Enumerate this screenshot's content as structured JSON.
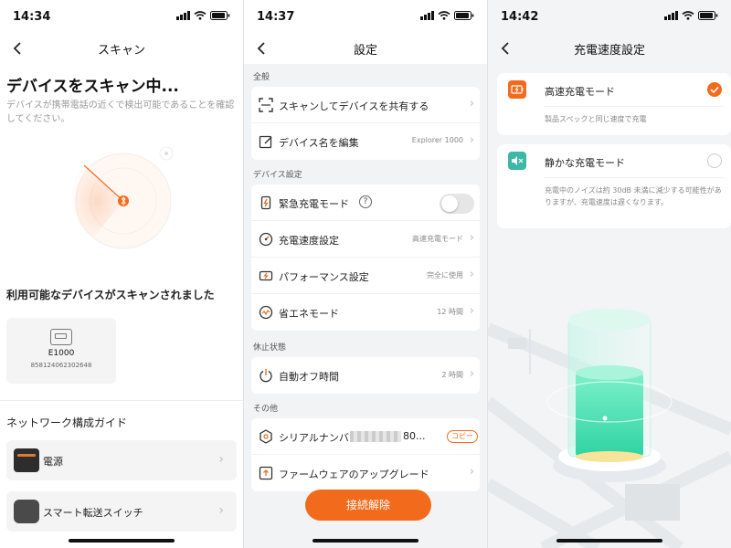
{
  "scan_screen": {
    "time": "14:34",
    "title": "スキャン",
    "heading": "デバイスをスキャン中...",
    "description": "デバイスが携帯電話の近くで検出可能であることを確認してください。",
    "found_heading": "利用可能なデバイスがスキャンされました",
    "device": {
      "name": "E1000",
      "serial": "858124062302648"
    },
    "guide_heading": "ネットワーク構成ガイド",
    "guide_items": [
      {
        "label": "電源"
      },
      {
        "label": "スマート転送スイッチ"
      }
    ]
  },
  "settings_screen": {
    "time": "14:37",
    "title": "設定",
    "sections": {
      "general": "全般",
      "device": "デバイス設定",
      "sleep": "休止状態",
      "other": "その他"
    },
    "general_rows": [
      {
        "label": "スキャンしてデバイスを共有する",
        "value": ""
      },
      {
        "label": "デバイス名を編集",
        "value": "Explorer 1000"
      }
    ],
    "device_rows": [
      {
        "label": "緊急充電モード",
        "value": ""
      },
      {
        "label": "充電速度設定",
        "value": "高速充電モード"
      },
      {
        "label": "パフォーマンス設定",
        "value": "完全に使用"
      },
      {
        "label": "省エネモード",
        "value": "12 時間"
      }
    ],
    "emergency_charge_enabled": false,
    "sleep_rows": [
      {
        "label": "自動オフ時間",
        "value": "2 時間"
      }
    ],
    "other_rows": [
      {
        "label": "シリアルナンバー: 8",
        "suffix": "80...",
        "action": "コピー"
      },
      {
        "label": "ファームウェアのアップグレード",
        "value": ""
      }
    ],
    "disconnect_label": "接続解除"
  },
  "charge_screen": {
    "time": "14:42",
    "title": "充電速度設定",
    "modes": [
      {
        "label": "高速充電モード",
        "desc": "製品スペックと同じ速度で充電",
        "selected": true
      },
      {
        "label": "静かな充電モード",
        "desc": "充電中のノイズは約 30dB 未満に減少する可能性がありますが、充電速度は遅くなります。",
        "selected": false
      }
    ]
  },
  "colors": {
    "accent": "#f26b1d",
    "quiet_mode_icon": "#3bb8a6",
    "battery_green": "#49e3b8",
    "group_bg": "#f2f3f5"
  },
  "icons": {
    "back": "chevron-left-icon",
    "chevron": "chevron-right-icon",
    "bluetooth": "bluetooth-icon"
  }
}
